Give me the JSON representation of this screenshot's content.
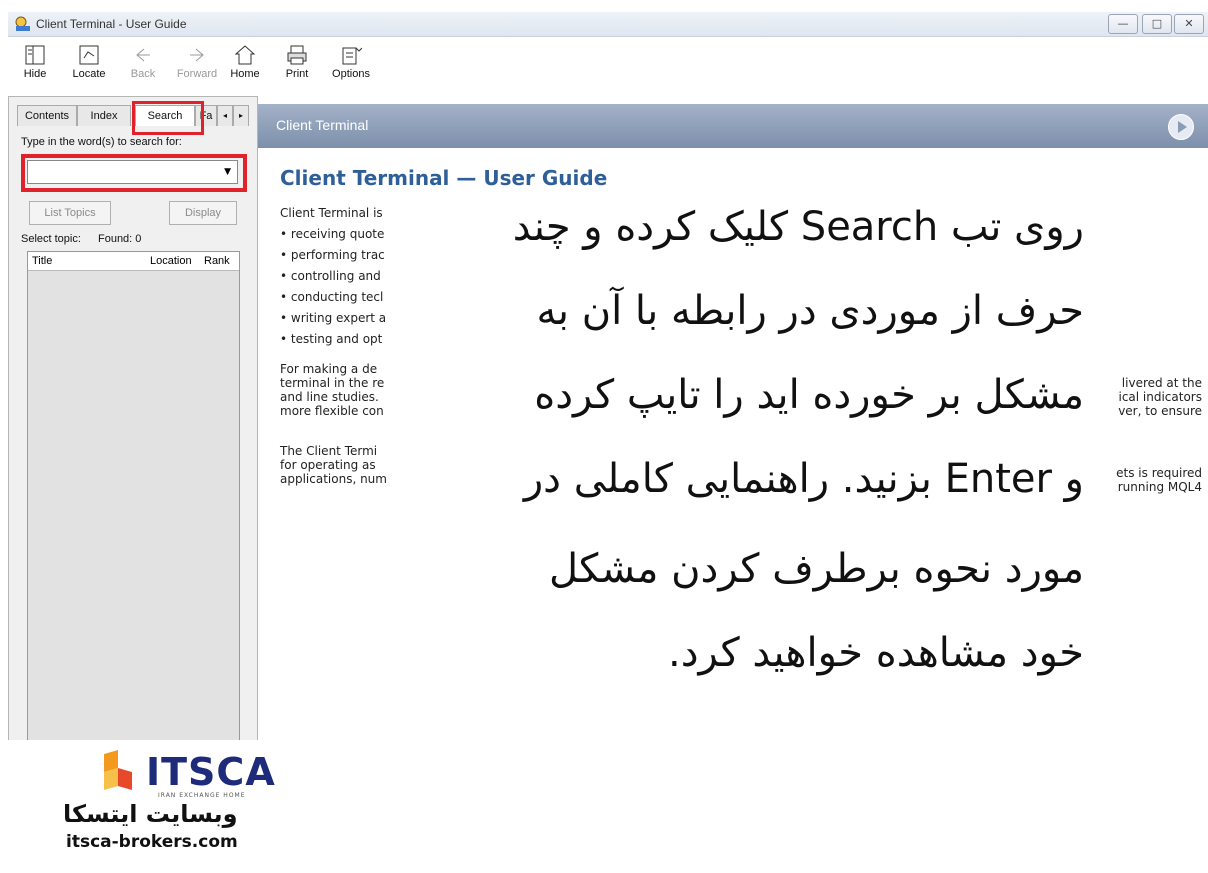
{
  "window": {
    "title": "Client Terminal - User Guide",
    "controls": {
      "minimize": "—",
      "maximize": "□",
      "close": "✕"
    }
  },
  "toolbar": {
    "items": [
      {
        "label": "Hide",
        "icon": "hide-icon",
        "enabled": true
      },
      {
        "label": "Locate",
        "icon": "locate-icon",
        "enabled": true
      },
      {
        "label": "Back",
        "icon": "back-arrow-icon",
        "enabled": false
      },
      {
        "label": "Forward",
        "icon": "forward-arrow-icon",
        "enabled": false
      },
      {
        "label": "Home",
        "icon": "home-icon",
        "enabled": true
      },
      {
        "label": "Print",
        "icon": "printer-icon",
        "enabled": true
      },
      {
        "label": "Options",
        "icon": "options-icon",
        "enabled": true
      }
    ]
  },
  "left_pane": {
    "tabs": [
      "Contents",
      "Index",
      "Search",
      "Fa"
    ],
    "active_tab": "Search",
    "prompt": "Type in the word(s) to search for:",
    "search_value": "",
    "list_topics_label": "List Topics",
    "display_label": "Display",
    "select_topic_label": "Select topic:",
    "found_label": "Found: 0",
    "columns": [
      "Title",
      "Location",
      "Rank"
    ]
  },
  "right_pane": {
    "header_title": "Client Terminal",
    "doc_title": "Client Terminal — User Guide",
    "left_lines": [
      "Client Terminal is",
      "• receiving quote",
      "• performing trac",
      "• controlling and",
      "• conducting tecl",
      "• writing expert a",
      "• testing and opt"
    ],
    "para1_left": [
      "For making a de",
      "terminal in the re",
      "and line studies.",
      "more flexible con"
    ],
    "para1_right": [
      "livered at the",
      "ical indicators",
      "ver, to ensure"
    ],
    "para2_left": [
      "The Client Termi",
      "for operating as",
      "applications, num"
    ],
    "para2_right": [
      "ets is required",
      "running MQL4"
    ]
  },
  "overlay_text": [
    "روی تب Search کلیک کرده و چند",
    "حرف از موردی در رابطه با آن به",
    "مشکل بر خورده اید را تایپ کرده",
    "و Enter بزنید. راهنمایی کاملی در",
    "مورد نحوه برطرف کردن مشکل",
    "خود مشاهده خواهید کرد."
  ],
  "logo": {
    "word": "ITSCA",
    "tagline": "IRAN EXCHANGE HOME",
    "persian": "وبسایت ایتسکا",
    "url": "itsca-brokers.com"
  },
  "colors": {
    "highlight": "#e0222a",
    "header_bar": "#8a9bb6",
    "doc_title": "#2f5f98",
    "logo_blue": "#1e2a7a",
    "logo_orange": "#f39a1e"
  }
}
